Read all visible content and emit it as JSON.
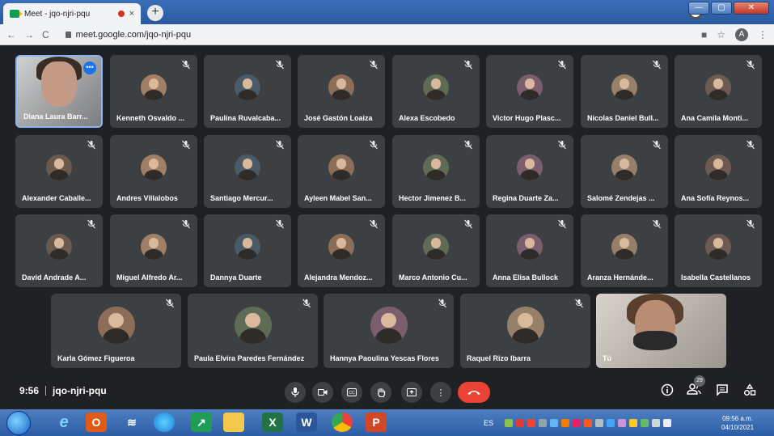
{
  "browser": {
    "tab_title": "Meet - jqo-njri-pqu",
    "tab_close": "×",
    "new_tab": "+",
    "url": "meet.google.com/jqo-njri-pqu",
    "profile_initial": "A",
    "nav": {
      "back": "←",
      "forward": "→",
      "reload": "C"
    },
    "window_buttons": {
      "minimize": "—",
      "maximize": "▢",
      "close": "✕"
    }
  },
  "participants_row1": [
    {
      "name": "Diana Laura Barr...",
      "self": true
    },
    {
      "name": "Kenneth Osvaldo ..."
    },
    {
      "name": "Paulina Ruvalcaba..."
    },
    {
      "name": "José Gastón Loaiza"
    },
    {
      "name": "Alexa Escobedo"
    },
    {
      "name": "Victor Hugo Plasc..."
    },
    {
      "name": "Nicolas Daniel Bull..."
    },
    {
      "name": "Ana Camila Monti..."
    }
  ],
  "participants_row2": [
    {
      "name": "Alexander Caballe..."
    },
    {
      "name": "Andres Villalobos"
    },
    {
      "name": "Santiago Mercur..."
    },
    {
      "name": "Ayleen Mabel San..."
    },
    {
      "name": "Hector Jimenez B..."
    },
    {
      "name": "Regina Duarte Za..."
    },
    {
      "name": "Salomé Zendejas ..."
    },
    {
      "name": "Ana Sofía Reynos..."
    }
  ],
  "participants_row3": [
    {
      "name": "David Andrade A..."
    },
    {
      "name": "Miguel Alfredo Ar..."
    },
    {
      "name": "Dannya Duarte"
    },
    {
      "name": "Alejandra Mendoz..."
    },
    {
      "name": "Marco Antonio Cu..."
    },
    {
      "name": "Anna Elisa Bullock"
    },
    {
      "name": "Aranza Hernánde..."
    },
    {
      "name": "Isabella Castellanos"
    }
  ],
  "participants_row4": [
    {
      "name": "Karla Gómez Figueroa"
    },
    {
      "name": "Paula Elvira Paredes Fernández"
    },
    {
      "name": "Hannya Paoulina Yescas Flores"
    },
    {
      "name": "Raquel Rizo Ibarra"
    },
    {
      "name": "Tú",
      "self_camera": true
    }
  ],
  "meet": {
    "time": "9:56",
    "meeting_code": "jqo-njri-pqu",
    "participant_count": "29"
  },
  "taskbar": {
    "language": "ES",
    "clock_time": "09:56 a.m.",
    "clock_date": "04/10/2021"
  }
}
